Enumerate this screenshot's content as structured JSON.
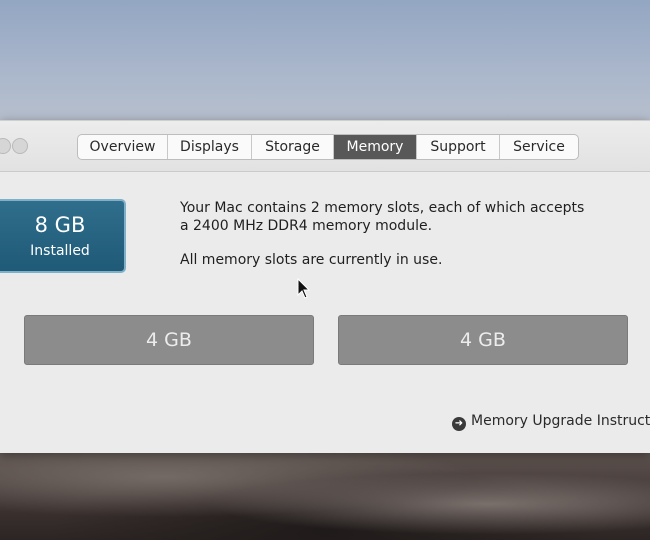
{
  "tabs": [
    {
      "label": "Overview",
      "active": false
    },
    {
      "label": "Displays",
      "active": false
    },
    {
      "label": "Storage",
      "active": false
    },
    {
      "label": "Memory",
      "active": true
    },
    {
      "label": "Support",
      "active": false
    },
    {
      "label": "Service",
      "active": false
    }
  ],
  "memory": {
    "installed_size": "8 GB",
    "installed_label": "Installed",
    "description_line1": "Your Mac contains 2 memory slots, each of which accepts",
    "description_line2": "a 2400 MHz DDR4 memory module.",
    "status": "All memory slots are currently in use.",
    "slots": [
      {
        "label": "4 GB"
      },
      {
        "label": "4 GB"
      }
    ],
    "upgrade_link": "Memory Upgrade Instructio"
  },
  "colors": {
    "active_tab": "#585858",
    "installed_box": "#246483",
    "slot": "#8c8c8c"
  },
  "icons": {
    "upgrade_link_icon": "arrow-right-circle-icon",
    "cursor": "mouse-pointer-icon"
  }
}
